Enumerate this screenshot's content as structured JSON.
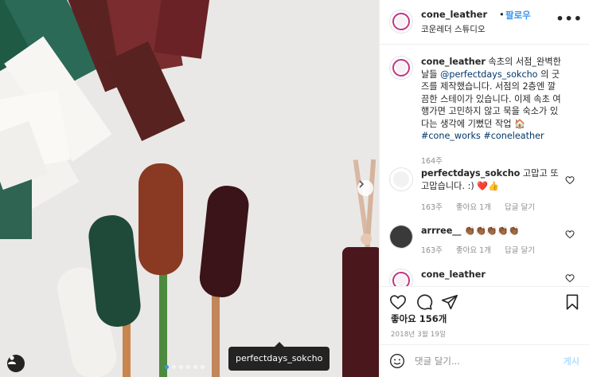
{
  "photo": {
    "tag_tooltip": "perfectdays_sokcho",
    "carousel_dots": 6,
    "active_dot": 0
  },
  "header": {
    "username": "cone_leather",
    "separator": "•",
    "follow_label": "팔로우",
    "location": "코운레더 스튜디오",
    "more_label": "•••"
  },
  "caption": {
    "username": "cone_leather",
    "text_1": " 속초의 서점_완벽한 날들",
    "mention": "@perfectdays_sokcho",
    "text_2": " 의 굿즈를 제작했습니다. 서점의 2층엔 깔끔한 스테이가 있습니다. 이제 속초 여행가면 고민하지 않고 묵을 숙소가 있다는 생각에 기뻤던 작업 ",
    "emoji": "🏠",
    "hashtag_1": "#cone_works",
    "hashtag_2": "#coneleather",
    "time": "164주"
  },
  "comments": [
    {
      "username": "perfectdays_sokcho",
      "text": " 고맙고 또 고맙습니다. :) ",
      "emoji": "❤️👍",
      "time": "163주",
      "likes": "좋아요 1개",
      "reply": "답글 달기"
    },
    {
      "username": "arrree__",
      "text": " ",
      "emoji": "👏🏾👏🏾👏🏾👏🏾👏🏾",
      "time": "163주",
      "likes": "좋아요 1개",
      "reply": "답글 달기"
    },
    {
      "username": "cone_leather",
      "text": ""
    }
  ],
  "engagement": {
    "likes": "좋아요 156개",
    "date": "2018년 3월 19일"
  },
  "composer": {
    "placeholder": "댓글 달기...",
    "post_label": "게시"
  },
  "colors": {
    "link_blue": "#3897f0",
    "text": "#262626",
    "muted": "#8e8e8e",
    "post_disabled": "#b2dffc"
  }
}
